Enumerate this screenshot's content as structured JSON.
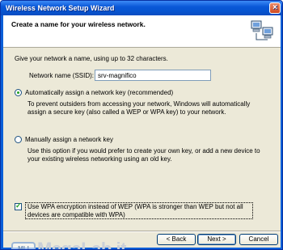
{
  "window": {
    "title": "Wireless Network Setup Wizard",
    "close_glyph": "×"
  },
  "header": {
    "title": "Create a name for your wireless network.",
    "icon": "network-computers-icon"
  },
  "content": {
    "intro": "Give your network a name, using up to 32 characters.",
    "ssid_label": "Network name (SSID):",
    "ssid_value": "srv-magnifico",
    "option_auto": {
      "label": "Automatically assign a network key (recommended)",
      "selected": true,
      "desc": "To prevent outsiders from accessing your network, Windows will automatically assign a secure key (also called a WEP or WPA key) to your network."
    },
    "option_manual": {
      "label": "Manually assign a network key",
      "selected": false,
      "desc": "Use this option if you would prefer to create your own key, or add a new device to your existing wireless networking using an old key."
    },
    "wpa_checkbox": {
      "label": "Use WPA encryption instead of WEP (WPA is stronger than WEP but not all devices are compatible with WPA)",
      "checked": true
    }
  },
  "buttons": {
    "back": "< Back",
    "next": "Next >",
    "cancel": "Cancel"
  },
  "watermark": {
    "logo": "MLI",
    "text_main": "MegaLab",
    "text_dot": ".",
    "text_tld": "it"
  },
  "colors": {
    "titlebar": "#0a58d8",
    "dialog_bg": "#ece9d8",
    "radio_dot": "#21a121"
  }
}
